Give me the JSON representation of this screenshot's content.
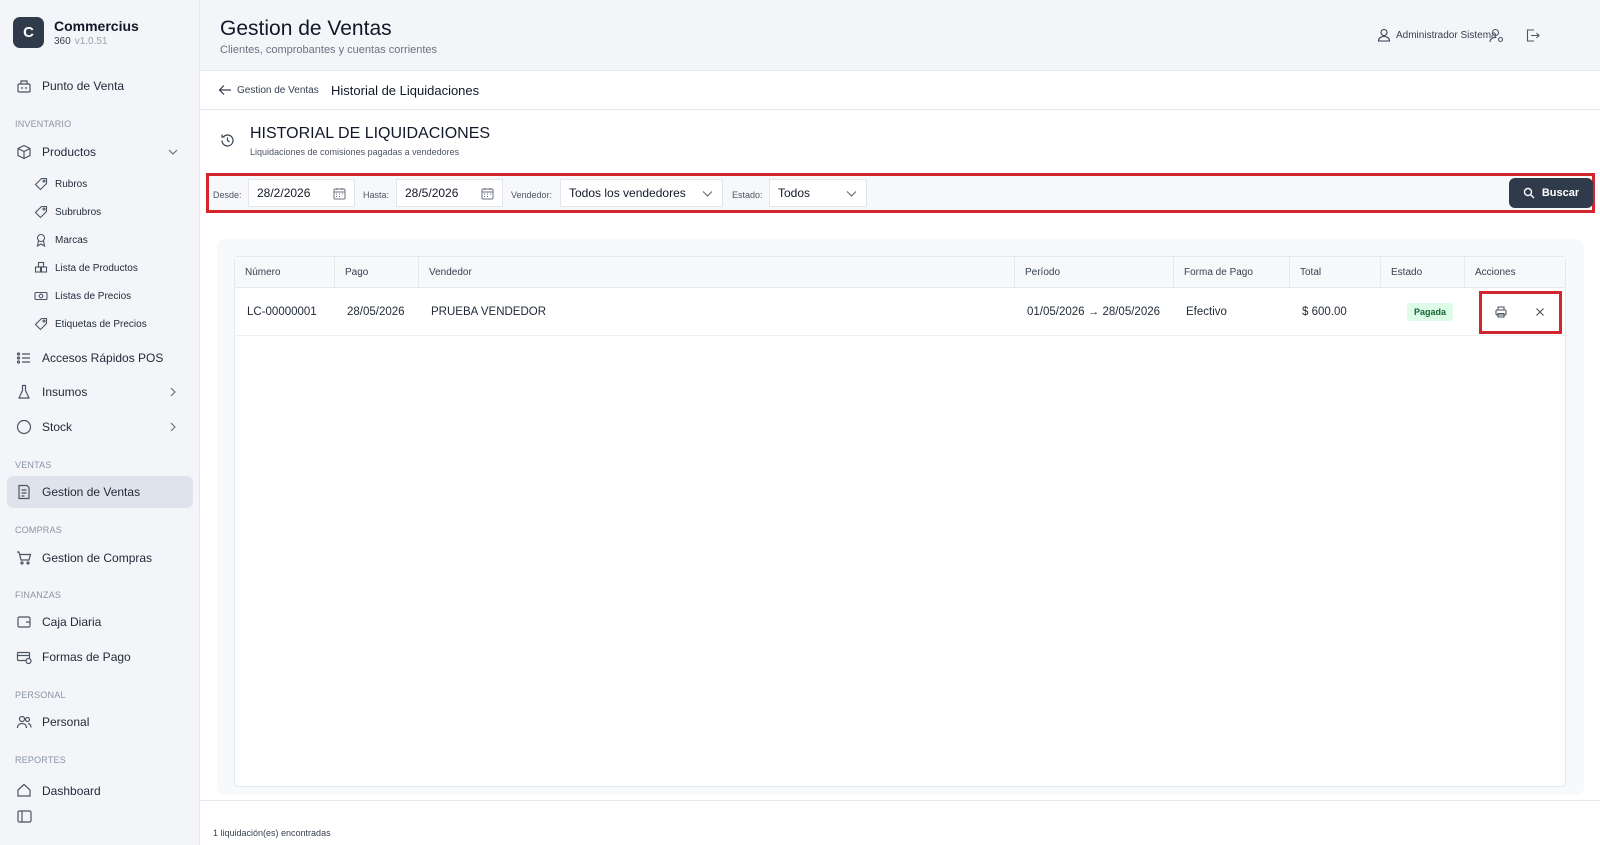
{
  "brand": {
    "logo_letter": "C",
    "name": "Commercius",
    "sub": "360",
    "version": "v1.0.51"
  },
  "sidebar": {
    "punto_venta": "Punto de Venta",
    "sec_inventario": "INVENTARIO",
    "productos": "Productos",
    "subitems": [
      "Rubros",
      "Subrubros",
      "Marcas",
      "Lista de Productos",
      "Listas de Precios",
      "Etiquetas de Precios"
    ],
    "accesos": "Accesos Rápidos POS",
    "insumos": "Insumos",
    "stock": "Stock",
    "sec_ventas": "VENTAS",
    "gestion_ventas": "Gestion de Ventas",
    "sec_compras": "COMPRAS",
    "gestion_compras": "Gestion de Compras",
    "sec_finanzas": "FINANZAS",
    "caja": "Caja Diaria",
    "formas": "Formas de Pago",
    "sec_personal": "PERSONAL",
    "personal": "Personal",
    "sec_reportes": "REPORTES",
    "dashboard": "Dashboard"
  },
  "header": {
    "title": "Gestion de Ventas",
    "subtitle": "Clientes, comprobantes y cuentas corrientes",
    "user": "Administrador Sistema"
  },
  "breadcrumb": {
    "back": "Gestion de Ventas",
    "current": "Historial de Liquidaciones"
  },
  "page": {
    "title": "HISTORIAL DE LIQUIDACIONES",
    "subtitle": "Liquidaciones de comisiones pagadas a vendedores"
  },
  "filters": {
    "desde_label": "Desde:",
    "desde_value": "28/2/2026",
    "hasta_label": "Hasta:",
    "hasta_value": "28/5/2026",
    "vendedor_label": "Vendedor:",
    "vendedor_value": "Todos los vendedores",
    "estado_label": "Estado:",
    "estado_value": "Todos",
    "buscar": "Buscar"
  },
  "table": {
    "columns": [
      "Número",
      "Pago",
      "Vendedor",
      "Período",
      "Forma de Pago",
      "Total",
      "Estado",
      "Acciones"
    ],
    "rows": [
      {
        "numero": "LC-00000001",
        "pago": "28/05/2026",
        "vendedor": "PRUEBA VENDEDOR",
        "periodo": "01/05/2026 → 28/05/2026",
        "forma": "Efectivo",
        "total": "$ 600.00",
        "estado": "Pagada"
      }
    ]
  },
  "footer": {
    "count": "1 liquidación(es) encontradas"
  },
  "colors": {
    "accent": "#2f3a4b",
    "highlight": "#d1262d",
    "badge_bg": "#dcfce7",
    "badge_fg": "#166534"
  }
}
